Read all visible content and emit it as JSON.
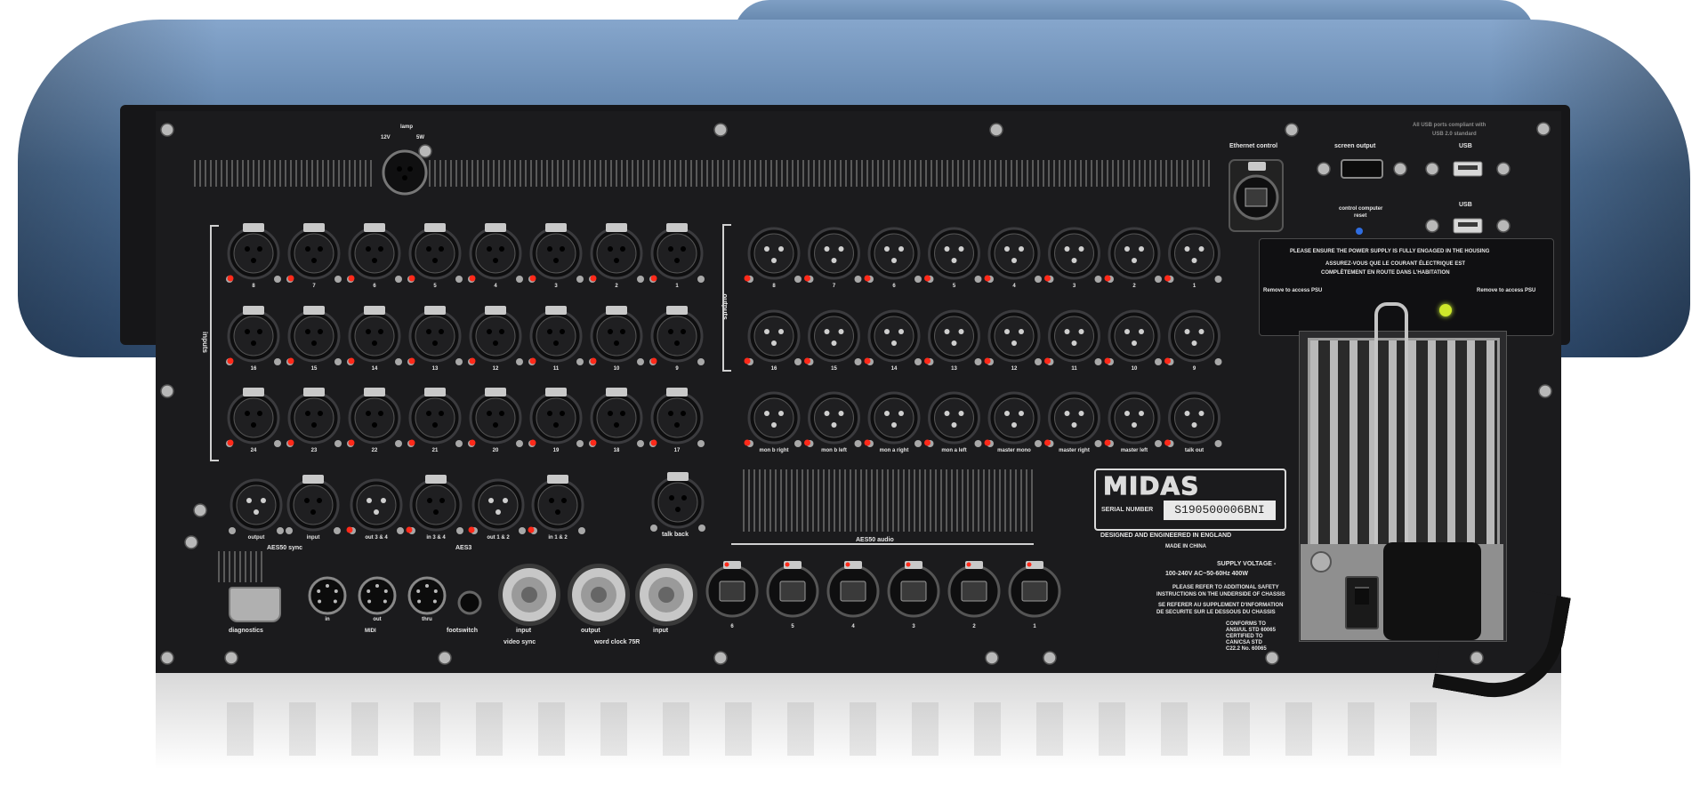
{
  "labels": {
    "lamp": "lamp",
    "lamp_12v": "12V",
    "lamp_5w": "5W",
    "ethernet_control": "Ethernet control",
    "screen_output": "screen output",
    "usb_top": "USB",
    "usb_bottom": "USB",
    "usb_note_line1": "All USB ports compliant with",
    "usb_note_line2": "USB 2.0 standard",
    "control_computer_reset_line1": "control computer",
    "control_computer_reset_line2": "reset",
    "warning_en": "PLEASE ENSURE THE POWER SUPPLY IS FULLY ENGAGED IN THE HOUSING",
    "warning_fr_line1": "ASSUREZ-VOUS QUE LE COURANT ÉLECTRIQUE EST",
    "warning_fr_line2": "COMPLÈTEMENT EN ROUTE DANS L'HABITATION",
    "remove_psu_left": "Remove to access PSU",
    "remove_psu_right": "Remove to access PSU",
    "inputs": "inputs",
    "outputs": "outputs",
    "aes50_sync": "AES50 sync",
    "aes3": "AES3",
    "talk_back": "talk back",
    "midi": "MIDI",
    "footswitch": "footswitch",
    "diagnostics": "diagnostics",
    "video_sync": "video sync",
    "word_clock": "word clock 75R",
    "aes50_audio": "AES50 audio",
    "designed": "DESIGNED AND ENGINEERED IN ENGLAND",
    "made_in": "MADE IN CHINA",
    "serial_number_label": "SERIAL NUMBER",
    "serial_number": "S190500006BNI",
    "brand": "MIDAS",
    "supply_voltage_title": "SUPPLY VOLTAGE -",
    "supply_voltage": "100-240V AC~50-60Hz 400W",
    "safety_1": "PLEASE REFER TO ADDITIONAL SAFETY",
    "safety_2": "INSTRUCTIONS ON THE UNDERSIDE OF CHASSIS",
    "safety_3": "SE REFERER AU SUPPLEMENT D'INFORMATION",
    "safety_4": "DE SECURITE SUR LE DESSOUS DU CHASSIS",
    "conforms_1": "CONFORMS TO",
    "conforms_2": "ANSI/UL STD 60065",
    "conforms_3": "CERTIFIED TO",
    "conforms_4": "CAN/CSA STD",
    "conforms_5": "C22.2 No. 60065"
  },
  "input_rows": [
    [
      "8",
      "7",
      "6",
      "5",
      "4",
      "3",
      "2",
      "1"
    ],
    [
      "16",
      "15",
      "14",
      "13",
      "12",
      "11",
      "10",
      "9"
    ],
    [
      "24",
      "23",
      "22",
      "21",
      "20",
      "19",
      "18",
      "17"
    ]
  ],
  "output_rows": [
    [
      "8",
      "7",
      "6",
      "5",
      "4",
      "3",
      "2",
      "1"
    ],
    [
      "16",
      "15",
      "14",
      "13",
      "12",
      "11",
      "10",
      "9"
    ],
    [
      "mon b right",
      "mon b left",
      "mon a right",
      "mon a left",
      "master mono",
      "master right",
      "master left",
      "talk out"
    ]
  ],
  "aux_connectors": [
    "output",
    "input",
    "out 3 & 4",
    "in 3 & 4",
    "out 1 & 2",
    "in 1 & 2"
  ],
  "midi_ports": [
    "in",
    "out",
    "thru"
  ],
  "bnc_ports": [
    "input",
    "output",
    "input"
  ],
  "aes50_ports": [
    "6",
    "5",
    "4",
    "3",
    "2",
    "1"
  ],
  "colors": {
    "chassis_blue": "#5a7ca4",
    "panel_black": "#1b1b1d",
    "led_red": "#ff2a1a",
    "psu_led": "#d6ff3a"
  },
  "icon_names": {
    "xlr_female": "xlr-female-icon",
    "xlr_male": "xlr-male-icon",
    "ethercon": "ethercon-icon",
    "usb": "usb-icon",
    "hdmi": "hdmi-icon",
    "bnc": "bnc-icon",
    "midi_din": "midi-din-icon",
    "power_inlet": "power-inlet-icon"
  }
}
